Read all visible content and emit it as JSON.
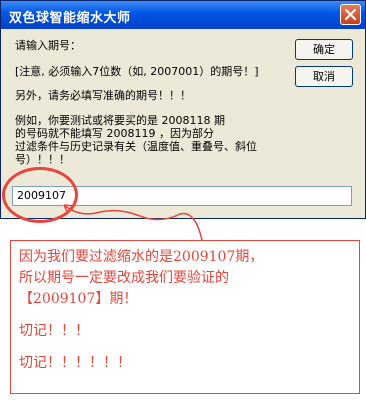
{
  "window": {
    "title": "双色球智能缩水大师",
    "close_icon": "close-icon"
  },
  "dialog": {
    "prompt": "请输入期号：",
    "notice": "[注意, 必须输入7位数（如, 2007001）的期号！]",
    "line_3": "另外，请务必填写准确的期号！！！",
    "example_1": "例如，你要测试或将要买的是 2008118 期",
    "example_2": "的号码就不能填写 2008119 ，因为部分",
    "example_3": "过滤条件与历史记录有关（温度值、重叠号、斜位",
    "example_4": "号）！！！",
    "ok_label": "确定",
    "cancel_label": "取消",
    "input_value": "2009107"
  },
  "annotation": {
    "line_1": "因为我们要过滤缩水的是2009107期，",
    "line_2": "所以期号一定要改成我们要验证的",
    "line_3": "【2009107】期！",
    "line_4": "切记！！！",
    "line_5": "切记！！！！！！",
    "color": "#e8453c"
  }
}
